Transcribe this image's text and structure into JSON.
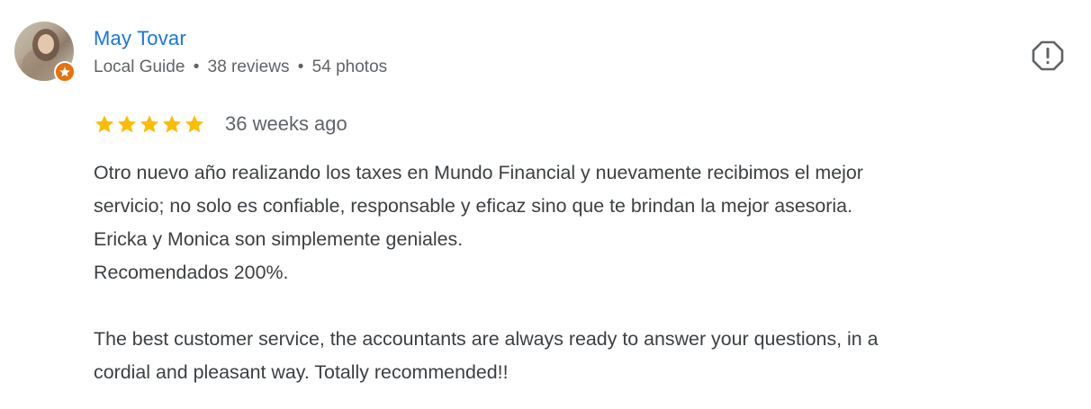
{
  "review": {
    "reviewer": {
      "name": "May Tovar",
      "level": "Local Guide",
      "reviews": "38 reviews",
      "photos": "54 photos",
      "separator": "•"
    },
    "rating": 5,
    "rating_max": 5,
    "date": "36 weeks ago",
    "text_es": [
      "Otro nuevo año realizando los taxes en Mundo Financial y nuevamente recibimos el mejor",
      "servicio; no solo es confiable, responsable y eficaz sino que te brindan la mejor asesoria.",
      "Ericka y Monica son simplemente geniales.",
      "Recomendados 200%."
    ],
    "text_en": [
      "The best customer service, the accountants are always ready to answer your questions, in a",
      "cordial and pleasant way. Totally recommended!!"
    ]
  },
  "colors": {
    "name_link": "#1a73e8",
    "meta": "#5f6368",
    "body_text": "#3c4043",
    "star": "#fbbc04",
    "badge": "#e8710a"
  },
  "icons": {
    "flag": "report-flag-icon",
    "badge": "local-guide-star-badge-icon",
    "star": "star-icon"
  }
}
